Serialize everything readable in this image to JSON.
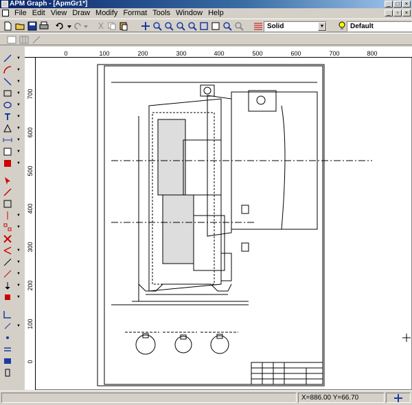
{
  "window": {
    "title": "APM Graph - [ApmGr1*]"
  },
  "menu": {
    "items": [
      "File",
      "Edit",
      "View",
      "Draw",
      "Modify",
      "Format",
      "Tools",
      "Window",
      "Help"
    ]
  },
  "toolbar": {
    "line_style": "Solid",
    "layer": "Default"
  },
  "ruler": {
    "h_ticks": [
      "0",
      "100",
      "200",
      "300",
      "400",
      "500",
      "600",
      "700",
      "800"
    ],
    "v_ticks": [
      "700",
      "600",
      "500",
      "400",
      "300",
      "200",
      "100",
      "0"
    ]
  },
  "status": {
    "coords": "X=886.00 Y=66.70"
  },
  "colors": {
    "titlebar": "#0a246a",
    "face": "#d4d0c8",
    "canvas": "#ffffff"
  }
}
